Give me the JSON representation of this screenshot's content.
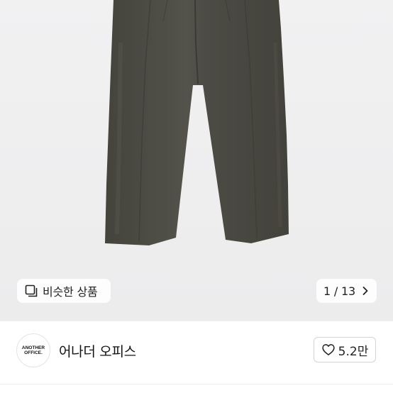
{
  "hero": {
    "image_desc": "pants-photo",
    "similar_button_label": "비슷한 상품",
    "image_counter": "1 / 13"
  },
  "shop": {
    "logo_line1": "ANOTHER",
    "logo_line2": "OFFICE.",
    "name": "어나더 오피스",
    "likes": "5.2만"
  },
  "colors": {
    "hero_bg": "#eeeeef",
    "product": "#4b4a43",
    "pill_bg": "#ffffff"
  }
}
